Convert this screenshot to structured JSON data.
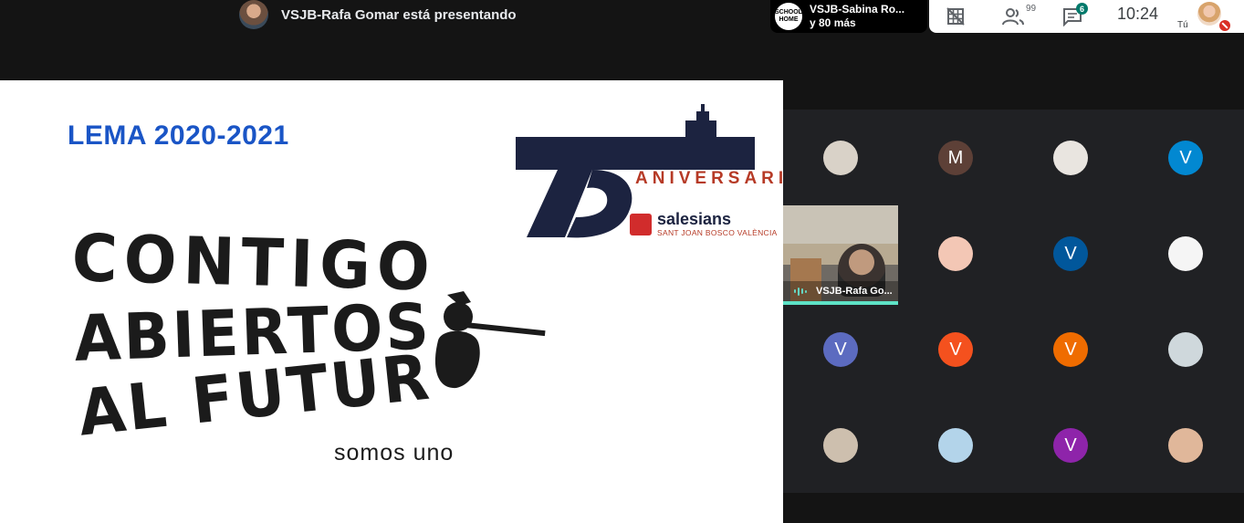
{
  "top_bar": {
    "presenter_text": "VSJB-Rafa Gomar está presentando",
    "others_name": "VSJB-Sabina Ro...",
    "others_more": "y 80 más",
    "school_logo_text": "SCHOOL HOME",
    "participants_count": "99",
    "chat_count": "6",
    "time": "10:24",
    "self_label": "Tú"
  },
  "slide": {
    "lema": "LEMA 2020-2021",
    "line1": "CONTIGO",
    "line2": "ABIERTOS",
    "line3": "AL FUTUR",
    "tagline": "somos uno",
    "anniversary_number": "75",
    "anniversary_word": "ANIVERSARI",
    "brand": "salesians",
    "brand_sub": "SANT JOAN BOSCO VALÈNCIA"
  },
  "participants": [
    {
      "initial": "",
      "color": "#d9d2c8"
    },
    {
      "initial": "M",
      "color": "#5d4037"
    },
    {
      "initial": "",
      "color": "#e9e5e0"
    },
    {
      "initial": "V",
      "color": "#0288d1"
    },
    {
      "initial": "",
      "color": "",
      "video": true,
      "name": "VSJB-Rafa Go..."
    },
    {
      "initial": "",
      "color": "#f3c7b5"
    },
    {
      "initial": "V",
      "color": "#01579b"
    },
    {
      "initial": "",
      "color": "#f5f5f5"
    },
    {
      "initial": "V",
      "color": "#5c6bc0"
    },
    {
      "initial": "V",
      "color": "#f4511e"
    },
    {
      "initial": "V",
      "color": "#ef6c00"
    },
    {
      "initial": "",
      "color": "#cfd8dc"
    },
    {
      "initial": "",
      "color": "#cdbfae"
    },
    {
      "initial": "",
      "color": "#b3d4ea"
    },
    {
      "initial": "V",
      "color": "#8e24aa"
    },
    {
      "initial": "",
      "color": "#e0b79a"
    }
  ]
}
